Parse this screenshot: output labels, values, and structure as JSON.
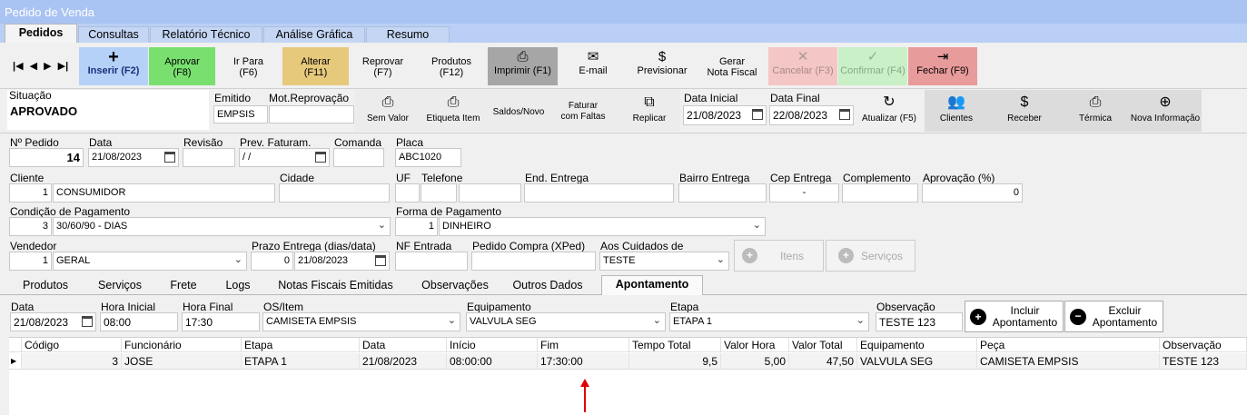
{
  "window": {
    "title": "Pedido de Venda"
  },
  "tabs": [
    "Pedidos",
    "Consultas",
    "Relatório Técnico",
    "Análise Gráfica",
    "Resumo"
  ],
  "nav": {
    "first": "|◀",
    "prev": "◀",
    "next": "▶",
    "last": "▶|"
  },
  "toolbar": {
    "inserir": "Inserir (F2)",
    "aprovar_1": "Aprovar",
    "aprovar_2": "(F8)",
    "irpara_1": "Ir Para",
    "irpara_2": "(F6)",
    "alterar_1": "Alterar",
    "alterar_2": "(F11)",
    "reprovar_1": "Reprovar",
    "reprovar_2": "(F7)",
    "produtos_1": "Produtos",
    "produtos_2": "(F12)",
    "imprimir": "Imprimir (F1)",
    "email": "E-mail",
    "previsionar": "Previsionar",
    "gerar_1": "Gerar",
    "gerar_2": "Nota Fiscal",
    "cancelar": "Cancelar (F3)",
    "confirmar": "Confirmar (F4)",
    "fechar": "Fechar (F9)"
  },
  "toolbar2": {
    "situacao_label": "Situação",
    "situacao_value": "APROVADO",
    "emitido_label": "Emitido",
    "emitido_value": "EMPSIS",
    "motrep_label": "Mot.Reprovação",
    "semvalor": "Sem Valor",
    "etiqueta": "Etiqueta Item",
    "saldos": "Saldos/Novo",
    "faturar_1": "Faturar",
    "faturar_2": "com Faltas",
    "replicar": "Replicar",
    "data_inicial_label": "Data Inicial",
    "data_inicial": "21/08/2023",
    "data_final_label": "Data Final",
    "data_final": "22/08/2023",
    "atualizar": "Atualizar (F5)",
    "clientes": "Clientes",
    "receber": "Receber",
    "termica": "Térmica",
    "nova_info": "Nova Informação"
  },
  "form": {
    "npedido_label": "Nº Pedido",
    "npedido": "14",
    "data_label": "Data",
    "data": "21/08/2023",
    "revisao_label": "Revisão",
    "prev_label": "Prev. Faturam.",
    "prev": " /  /",
    "comanda_label": "Comanda",
    "placa_label": "Placa",
    "placa": "ABC1020",
    "cliente_label": "Cliente",
    "cliente_cod": "1",
    "cliente_nome": "CONSUMIDOR",
    "cidade_label": "Cidade",
    "uf_label": "UF",
    "telefone_label": "Telefone",
    "end_label": "End. Entrega",
    "bairro_label": "Bairro Entrega",
    "cep_label": "Cep Entrega",
    "cep": "-",
    "compl_label": "Complemento",
    "aprov_label": "Aprovação (%)",
    "aprov": "0",
    "cond_label": "Condição de Pagamento",
    "cond_cod": "3",
    "cond": "30/60/90 - DIAS",
    "forma_label": "Forma de Pagamento",
    "forma_cod": "1",
    "forma": "DINHEIRO",
    "vend_label": "Vendedor",
    "vend_cod": "1",
    "vend": "GERAL",
    "prazo_label": "Prazo Entrega (dias/data)",
    "prazo_dias": "0",
    "prazo_data": "21/08/2023",
    "nf_label": "NF Entrada",
    "pedcompra_label": "Pedido Compra (XPed)",
    "cuidados_label": "Aos Cuidados de",
    "cuidados": "TESTE",
    "itens": "Itens",
    "servicos": "Serviços"
  },
  "bottom_tabs": [
    "Produtos",
    "Serviços",
    "Frete",
    "Logs",
    "Notas Fiscais Emitidas",
    "Observações",
    "Outros Dados",
    "Apontamento"
  ],
  "apont": {
    "data_label": "Data",
    "data": "21/08/2023",
    "hi_label": "Hora Inicial",
    "hi": "08:00",
    "hf_label": "Hora Final",
    "hf": "17:30",
    "os_label": "OS/Item",
    "os": "CAMISETA EMPSIS",
    "eq_label": "Equipamento",
    "eq": "VALVULA SEG",
    "etapa_label": "Etapa",
    "etapa": "ETAPA 1",
    "obs_label": "Observação",
    "obs": "TESTE 123",
    "incluir_1": "Incluir",
    "incluir_2": "Apontamento",
    "excluir_1": "Excluir",
    "excluir_2": "Apontamento"
  },
  "grid": {
    "columns": [
      "Código",
      "Funcionário",
      "Etapa",
      "Data",
      "Início",
      "Fim",
      "Tempo Total",
      "Valor Hora",
      "Valor Total",
      "Equipamento",
      "Peça",
      "Observação"
    ],
    "rows": [
      [
        "3",
        "JOSE",
        "ETAPA 1",
        "21/08/2023",
        "08:00:00",
        "17:30:00",
        "9,5",
        "5,00",
        "47,50",
        "VALVULA SEG",
        "CAMISETA EMPSIS",
        "TESTE 123"
      ]
    ]
  },
  "colors": {
    "title": "#a9c3f2",
    "aprovar": "#79e06f",
    "alterar": "#e7c97c",
    "imprimir": "#a6a6a6",
    "cancelar": "#f4c6c6",
    "confirmar": "#c9f0c6",
    "fechar": "#e89b9b",
    "arrow": "#e00000"
  }
}
